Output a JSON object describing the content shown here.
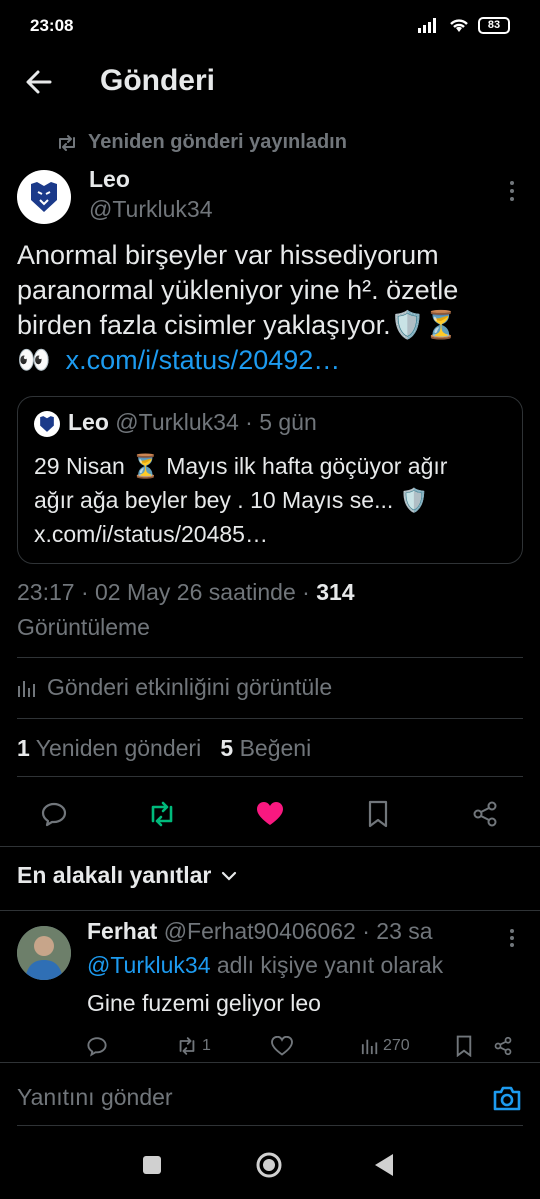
{
  "status_bar": {
    "time": "23:08",
    "battery": "83"
  },
  "header": {
    "title": "Gönderi"
  },
  "post": {
    "repost_notice": "Yeniden gönderi yayınladın",
    "author_name": "Leo",
    "author_handle": "@Turkluk34",
    "text_line1": "Anormal birşeyler var hissediyorum",
    "text_line2": "paranormal yükleniyor yine h².  özetle",
    "text_line3": "birden fazla cisimler yaklaşıyor.🛡️⏳",
    "text_emoji": "👀",
    "link": "x.com/i/status/20492…",
    "timestamp": "23:17 · 02 May 26 saatinde ·",
    "views_count": "314",
    "views_label": "Görüntüleme",
    "activity_label": "Gönderi etkinliğini görüntüle",
    "reposts_count": "1",
    "reposts_label": "Yeniden gönderi",
    "likes_count": "5",
    "likes_label": "Beğeni"
  },
  "quote": {
    "author_name": "Leo",
    "author_handle": "@Turkluk34",
    "time": "· 5 gün",
    "line1": "29 Nisan ⏳ Mayıs ilk hafta göçüyor ağır",
    "line2": "ağır ağa beyler bey . 10 Mayıs se... 🛡️",
    "line3": "x.com/i/status/20485…"
  },
  "replies_sort": {
    "label": "En alakalı yanıtlar"
  },
  "reply": {
    "author_name": "Ferhat",
    "author_handle": "@Ferhat90406062",
    "time": "· 23 sa",
    "reply_to_handle": "@Turkluk34",
    "reply_to_suffix": "adlı kişiye yanıt olarak",
    "text": "Gine fuzemi geliyor leo",
    "repost_count": "1",
    "views_count": "270"
  },
  "composer": {
    "placeholder": "Yanıtını gönder"
  },
  "colors": {
    "accent": "#1d9bf0",
    "repost_green": "#00ba7c",
    "like_pink": "#f91880",
    "muted": "#71767b"
  }
}
